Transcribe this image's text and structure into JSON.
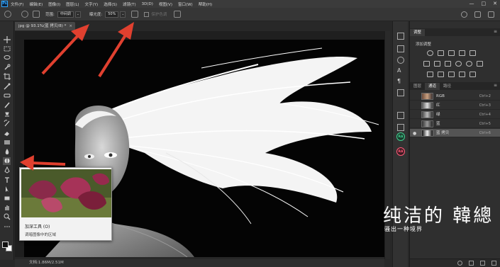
{
  "app": {
    "logo_text": "Ps",
    "accent": "#31a8ff",
    "menu": [
      "文件(F)",
      "编辑(E)",
      "图像(I)",
      "图层(L)",
      "文字(Y)",
      "选择(S)",
      "滤镜(T)",
      "3D(D)",
      "视图(V)",
      "窗口(W)",
      "帮助(H)"
    ],
    "window_controls": [
      "—",
      "□",
      "✕"
    ]
  },
  "options_bar": {
    "range_label": "范围:",
    "range_value": "中间调",
    "exposure_label": "曝光度:",
    "exposure_value": "50%",
    "protect_tone_label": "保护色调"
  },
  "document": {
    "tab_title": "jpg @ 93.1%(蓝 拷贝/8) *",
    "close_glyph": "×",
    "status": "文档:1.86M/2.51M"
  },
  "toolbar": {
    "tools": [
      "move-tool",
      "marquee-tool",
      "lasso-tool",
      "quick-select-tool",
      "crop-tool",
      "eyedropper-tool",
      "healing-brush-tool",
      "brush-tool",
      "clone-stamp-tool",
      "history-brush-tool",
      "eraser-tool",
      "gradient-tool",
      "blur-tool",
      "burn-tool",
      "pen-tool",
      "type-tool",
      "path-select-tool",
      "rectangle-tool",
      "hand-tool",
      "zoom-tool",
      "more-tools"
    ],
    "foreground_color": "#111111",
    "background_color": "#ffffff"
  },
  "tooltip": {
    "title": "加深工具 (O)",
    "description": "调暗图像中的区域"
  },
  "panels": {
    "adjust_tab": "调整",
    "adjust_subtitle": "添加调整",
    "channel_tabs": [
      "图层",
      "通道",
      "路径"
    ],
    "active_channel_tab": "通道",
    "menu_glyph": "≡",
    "channels": [
      {
        "name": "RGB",
        "shortcut": "Ctrl+2",
        "active": false
      },
      {
        "name": "红",
        "shortcut": "Ctrl+3",
        "active": false
      },
      {
        "name": "绿",
        "shortcut": "Ctrl+4",
        "active": false
      },
      {
        "name": "蓝",
        "shortcut": "Ctrl+5",
        "active": false
      },
      {
        "name": "蓝 拷贝",
        "shortcut": "Ctrl+6",
        "active": true
      }
    ],
    "eye_glyph": "●"
  },
  "side_badges": [
    "RA",
    "RA"
  ],
  "watermark": {
    "main": "纯洁的 韓總",
    "sub": "骚出一种境界"
  },
  "annotation_color": "#e0402f"
}
